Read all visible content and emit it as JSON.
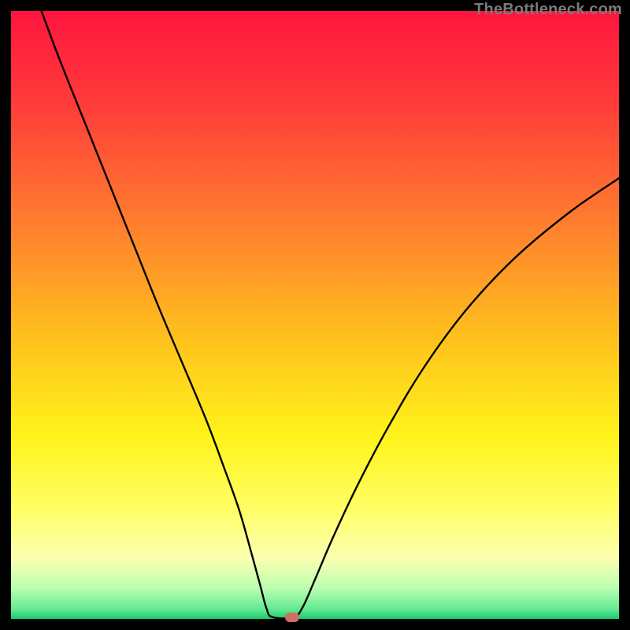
{
  "attribution": {
    "text": "TheBottleneck.com"
  },
  "chart_data": {
    "type": "line",
    "title": "",
    "xlabel": "",
    "ylabel": "",
    "xlim": [
      0,
      100
    ],
    "ylim": [
      0,
      100
    ],
    "grid": false,
    "legend": false,
    "background": {
      "type": "vertical-gradient",
      "stops": [
        {
          "offset": 0.0,
          "color": "#ff153e"
        },
        {
          "offset": 0.15,
          "color": "#ff3b3a"
        },
        {
          "offset": 0.35,
          "color": "#ff7e2e"
        },
        {
          "offset": 0.55,
          "color": "#ffc51c"
        },
        {
          "offset": 0.7,
          "color": "#fff31a"
        },
        {
          "offset": 0.82,
          "color": "#ffff66"
        },
        {
          "offset": 0.9,
          "color": "#fbffb0"
        },
        {
          "offset": 0.95,
          "color": "#b9ffb0"
        },
        {
          "offset": 0.985,
          "color": "#5fe891"
        },
        {
          "offset": 1.0,
          "color": "#18c96e"
        }
      ]
    },
    "series": [
      {
        "name": "bottleneck-curve",
        "color": "#000000",
        "x": [
          5,
          8,
          12,
          16,
          20,
          24,
          28,
          32,
          35,
          37.5,
          39.5,
          41.0,
          42.0,
          43.0,
          46.5,
          48.0,
          50.0,
          53.0,
          57.0,
          62.0,
          68.0,
          75.0,
          83.0,
          92.0,
          100.0
        ],
        "y": [
          100,
          92,
          82,
          72,
          62,
          52,
          42.5,
          33,
          25,
          18,
          11,
          5.5,
          1.8,
          0.3,
          0.3,
          2.0,
          6.5,
          13.5,
          22.0,
          31.5,
          41.5,
          51.0,
          59.5,
          67.0,
          72.5
        ]
      }
    ],
    "flat_segment": {
      "x_start": 43.0,
      "x_end": 46.5,
      "y": 0.3
    },
    "marker": {
      "x": 46.2,
      "y": 0.3,
      "color": "#cf6f62"
    }
  }
}
